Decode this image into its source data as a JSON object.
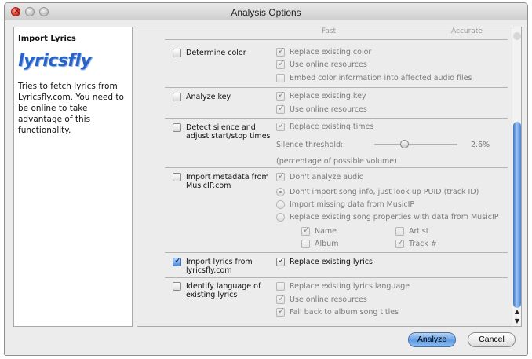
{
  "window": {
    "title": "Analysis Options"
  },
  "info": {
    "heading": "Import Lyrics",
    "logo_text": "lyricsfly",
    "desc_pre": "Tries to fetch lyrics from",
    "desc_link": "Lyricsfly.com",
    "desc_post": ". You need to be online to take advantage of this functionality."
  },
  "scale": {
    "fast": "Fast",
    "accurate": "Accurate"
  },
  "analyses": {
    "determine_color": {
      "label": "Determine color",
      "checked": false,
      "options": [
        "Replace existing color",
        "Use online resources",
        "Embed color information into affected audio files"
      ]
    },
    "analyze_key": {
      "label": "Analyze key",
      "checked": false,
      "options": [
        "Replace existing key",
        "Use online resources"
      ]
    },
    "silence": {
      "label_line1": "Detect silence and",
      "label_line2": "adjust start/stop times",
      "checked": false,
      "option": "Replace existing times",
      "threshold_label": "Silence threshold:",
      "threshold_value": "2.6%",
      "threshold_note": "(percentage of possible volume)"
    },
    "musicip": {
      "label_line1": "Import metadata from",
      "label_line2": "MusicIP.com",
      "checked": false,
      "dont_analyze": "Don't analyze audio",
      "radio1": "Don't import song info, just look up PUID (track ID)",
      "radio2": "Import missing data from MusicIP",
      "radio3": "Replace existing song properties with data from MusicIP",
      "fields": {
        "name": "Name",
        "artist": "Artist",
        "album": "Album",
        "track": "Track #"
      }
    },
    "lyrics": {
      "label_line1": "Import lyrics from",
      "label_line2": "lyricsfly.com",
      "checked": true,
      "option": "Replace existing lyrics"
    },
    "language": {
      "label_line1": "Identify language of",
      "label_line2": "existing lyrics",
      "checked": false,
      "options": [
        "Replace existing lyrics language",
        "Use online resources",
        "Fall back to album song titles"
      ]
    }
  },
  "buttons": {
    "analyze": "Analyze",
    "cancel": "Cancel"
  },
  "colors": {
    "accent": "#5f9ce3",
    "link_logo": "#2a63c7"
  }
}
